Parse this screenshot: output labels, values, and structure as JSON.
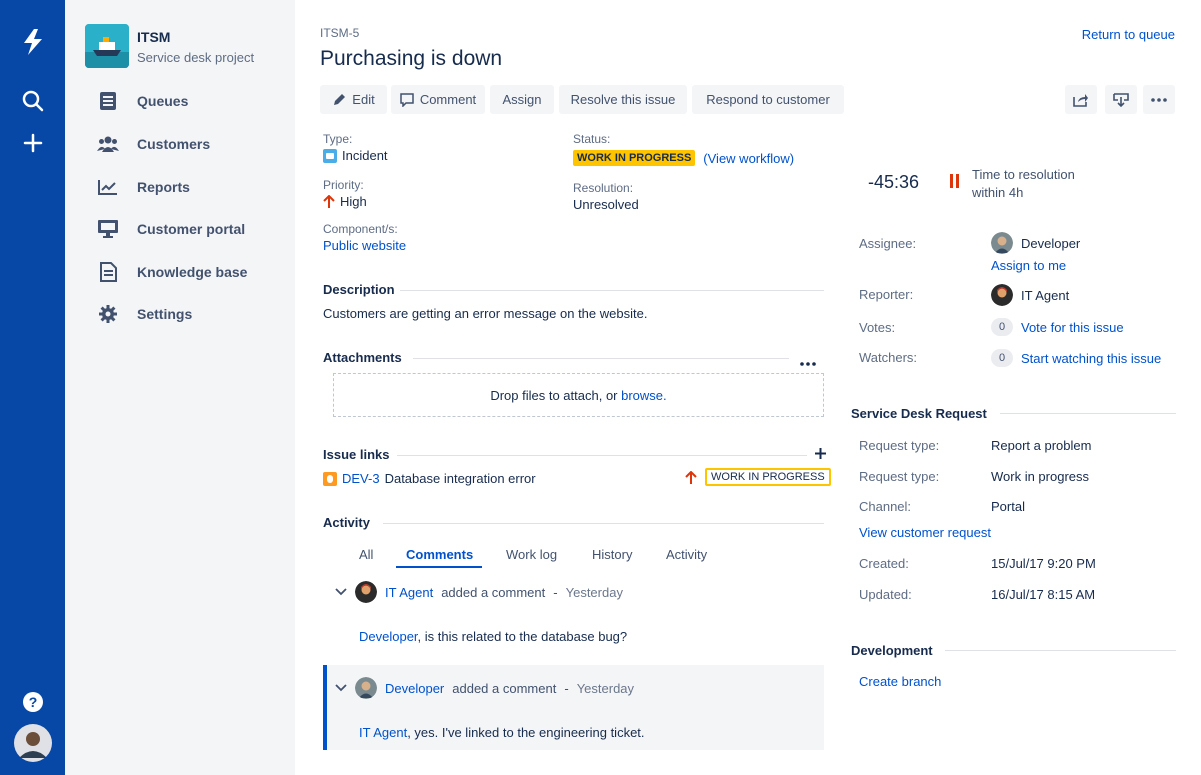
{
  "global_nav": {
    "logo_icon": "jira-logo-icon",
    "search_icon": "search-icon",
    "create_icon": "plus-icon",
    "help_icon": "help-icon",
    "profile_icon": "user-avatar"
  },
  "project": {
    "name": "ITSM",
    "type": "Service desk project",
    "nav": [
      {
        "label": "Queues",
        "icon": "queues-icon"
      },
      {
        "label": "Customers",
        "icon": "customers-icon"
      },
      {
        "label": "Reports",
        "icon": "reports-icon"
      },
      {
        "label": "Customer portal",
        "icon": "monitor-icon"
      },
      {
        "label": "Knowledge base",
        "icon": "document-icon"
      },
      {
        "label": "Settings",
        "icon": "gear-icon"
      }
    ]
  },
  "issue": {
    "key": "ITSM-5",
    "title": "Purchasing is down",
    "return_link": "Return to queue"
  },
  "toolbar": {
    "edit": "Edit",
    "comment": "Comment",
    "assign": "Assign",
    "resolve": "Resolve this issue",
    "respond": "Respond to customer",
    "share_icon": "share-icon",
    "export_icon": "export-icon",
    "more_icon": "more-icon"
  },
  "details": {
    "type_label": "Type:",
    "type_value": "Incident",
    "priority_label": "Priority:",
    "priority_value": "High",
    "component_label": "Component/s:",
    "component_value": "Public website",
    "status_label": "Status:",
    "status_value": "WORK IN PROGRESS",
    "view_workflow": "(View workflow)",
    "resolution_label": "Resolution:",
    "resolution_value": "Unresolved"
  },
  "description": {
    "heading": "Description",
    "text": "Customers are getting an error message on the website."
  },
  "attachments": {
    "heading": "Attachments",
    "drop_text": "Drop files to attach, or",
    "browse": "browse."
  },
  "issue_links": {
    "heading": "Issue links",
    "key": "DEV-3",
    "summary": "Database integration error",
    "status": "WORK IN PROGRESS"
  },
  "activity": {
    "heading": "Activity",
    "tabs": [
      "All",
      "Comments",
      "Work log",
      "History",
      "Activity"
    ],
    "comments": [
      {
        "author": "IT Agent",
        "action": "added a comment",
        "sep": "-",
        "time": "Yesterday",
        "mention": "Developer",
        "text": ", is this related to the database bug?"
      },
      {
        "author": "Developer",
        "action": "added a comment",
        "sep": "-",
        "time": "Yesterday",
        "mention": "IT Agent",
        "text": ", yes. I've linked to the engineering ticket."
      }
    ]
  },
  "sla": {
    "time": "-45:36",
    "label": "Time to resolution",
    "goal": "within 4h"
  },
  "people": {
    "assignee_label": "Assignee:",
    "assignee": "Developer",
    "assign_to_me": "Assign to me",
    "reporter_label": "Reporter:",
    "reporter": "IT Agent",
    "votes_label": "Votes:",
    "votes_count": "0",
    "vote_link": "Vote for this issue",
    "watchers_label": "Watchers:",
    "watchers_count": "0",
    "watch_link": "Start watching this issue"
  },
  "sd_request": {
    "heading": "Service Desk Request",
    "rows": [
      {
        "label": "Request type:",
        "value": "Report a problem"
      },
      {
        "label": "Request type:",
        "value": "Work in progress"
      },
      {
        "label": "Channel:",
        "value": "Portal"
      }
    ],
    "view_link": "View customer request",
    "created_label": "Created:",
    "created": "15/Jul/17 9:20 PM",
    "updated_label": "Updated:",
    "updated": "16/Jul/17 8:15 AM"
  },
  "development": {
    "heading": "Development",
    "create_branch": "Create branch"
  },
  "colors": {
    "global_nav": "#0747a6",
    "sidebar": "#f4f5f7",
    "link": "#0052cc",
    "wip": "#ffc400",
    "priority_high": "#de350b"
  }
}
